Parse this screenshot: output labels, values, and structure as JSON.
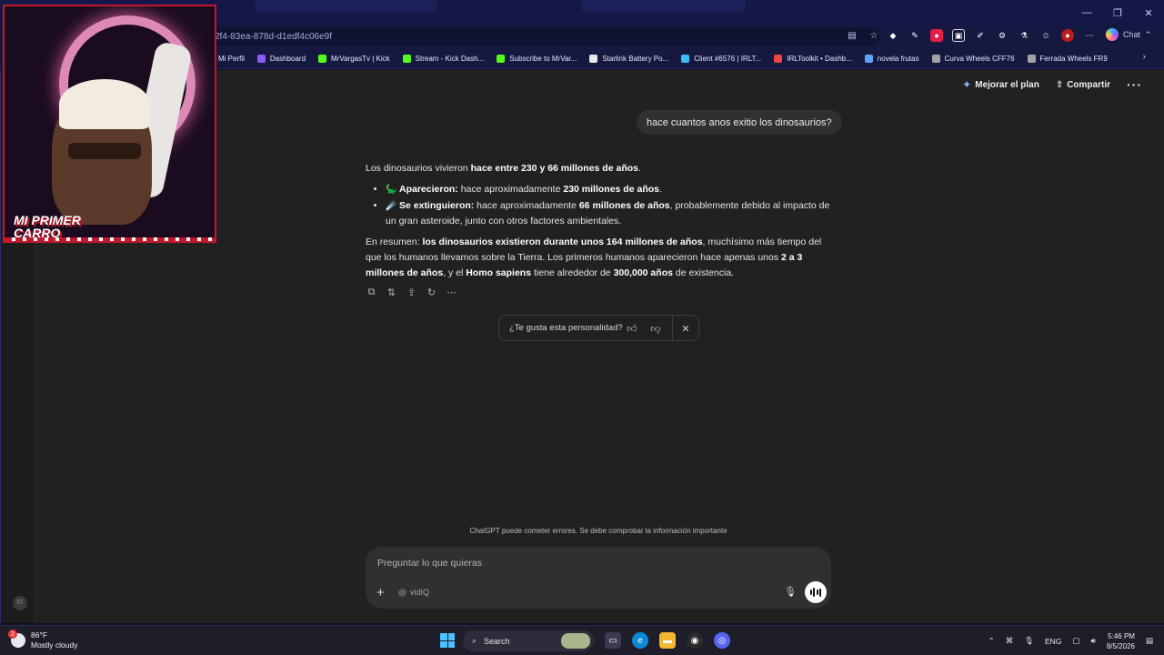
{
  "browser": {
    "url": "2f4-83ea-878d-d1edf4c06e9f",
    "copilot_label": "Chat",
    "bookmarks": [
      {
        "label": "Mi Perfil",
        "color": "#2f6fdb"
      },
      {
        "label": "Dashboard",
        "color": "#8b5cf6"
      },
      {
        "label": "MrVargasTv | Kick",
        "color": "#53fc18"
      },
      {
        "label": "Stream - Kick Dash...",
        "color": "#53fc18"
      },
      {
        "label": "Subscribe to MrVar...",
        "color": "#53fc18"
      },
      {
        "label": "Starlink Battery Po...",
        "color": "#e8e8e8"
      },
      {
        "label": "Client #6576 | IRLT...",
        "color": "#38bdf8"
      },
      {
        "label": "IRLToolkit • Dashb...",
        "color": "#ef4444"
      },
      {
        "label": "novela frutas",
        "color": "#60a5fa"
      },
      {
        "label": "Curva Wheels CFF76",
        "color": "#a3a3a3"
      },
      {
        "label": "Ferrada Wheels FR9",
        "color": "#a3a3a3"
      }
    ]
  },
  "chat": {
    "upgrade_label": "Mejorar el plan",
    "share_label": "Compartir",
    "user_message": "hace cuantos anos exitio los dinosaurios?",
    "answer": {
      "intro_text": "Los dinosaurios vivieron ",
      "intro_bold": "hace entre 230 y 66 millones de años",
      "intro_end": ".",
      "bullet1_emoji": "🦕",
      "bullet1_label": "Aparecieron:",
      "bullet1_text": " hace aproximadamente ",
      "bullet1_bold": "230 millones de años",
      "bullet1_end": ".",
      "bullet2_emoji": "☄️",
      "bullet2_label": "Se extinguieron:",
      "bullet2_text": " hace aproximadamente ",
      "bullet2_bold": "66 millones de años",
      "bullet2_end": ", probablemente debido al impacto de un gran asteroide, junto con otros factores ambientales.",
      "summary_start": "En resumen: ",
      "summary_bold1": "los dinosaurios existieron durante unos 164 millones de años",
      "summary_text1": ", muchísimo más tiempo del que los humanos llevamos sobre la Tierra. Los primeros humanos aparecieron hace apenas unos ",
      "summary_bold2": "2 a 3 millones de años",
      "summary_text2": ", y el ",
      "summary_bold3": "Homo sapiens",
      "summary_text3": " tiene alrededor de ",
      "summary_bold4": "300,000 años",
      "summary_text4": " de existencia."
    },
    "feedback_question": "¿Te gusta esta personalidad?",
    "disclaimer": "ChatGPT puede cometer errores. Se debe comprobar la información importante",
    "composer_placeholder": "Preguntar lo que quieras",
    "tool_label": "vidIQ",
    "rail_avatar": "ST"
  },
  "webcam": {
    "banner_line1": "MI PRIMER",
    "banner_line2": "CARRO"
  },
  "taskbar": {
    "weather_badge": "2",
    "temperature": "86°F",
    "condition": "Mostly cloudy",
    "search_label": "Search",
    "language": "ENG",
    "time": "5:46 PM",
    "date": "8/5/2026"
  }
}
